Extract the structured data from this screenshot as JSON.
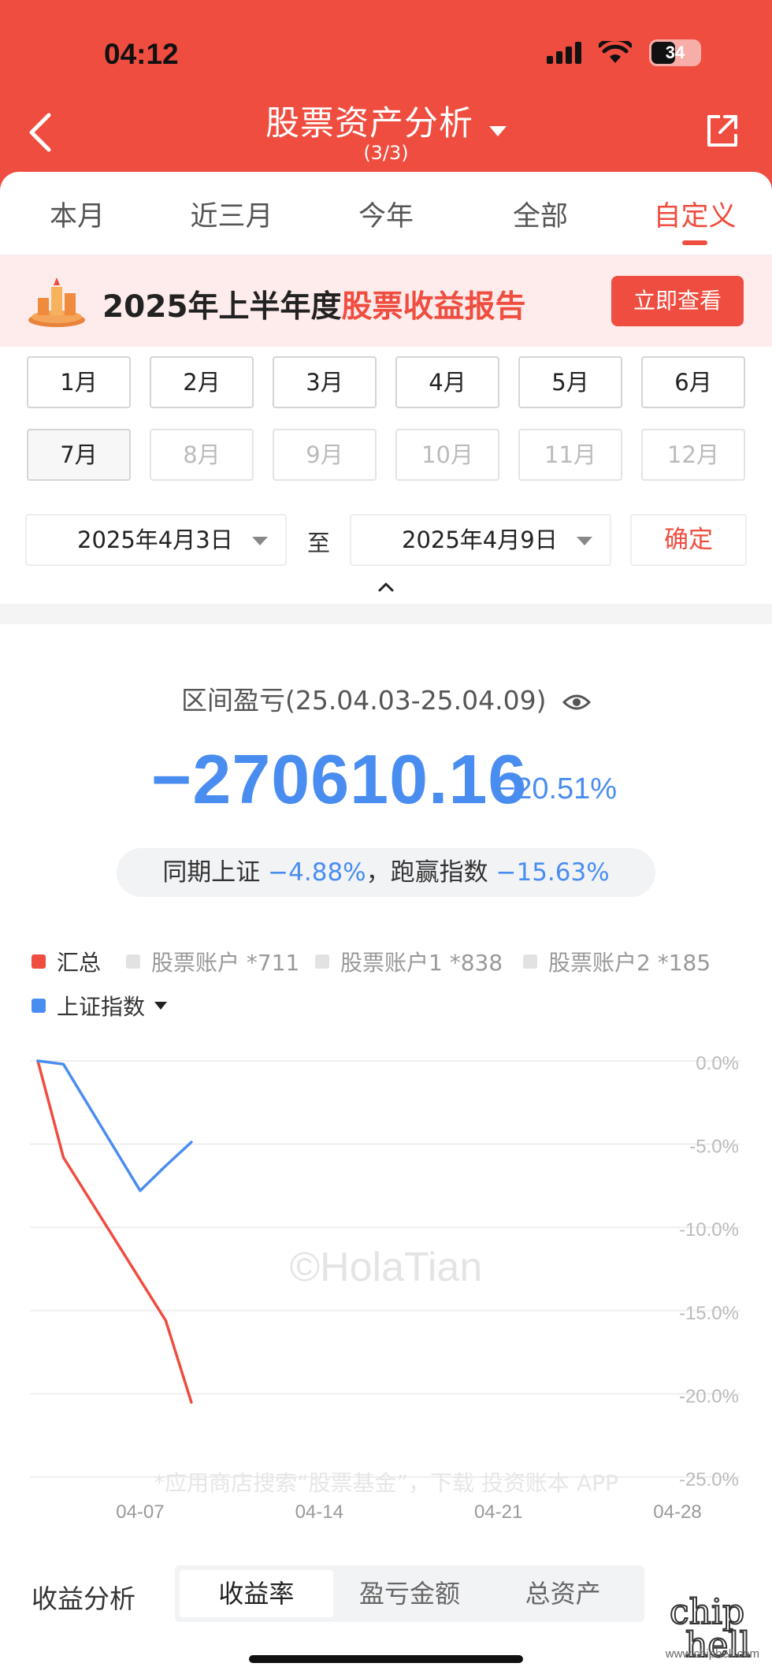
{
  "status_bar": {
    "time": "04:12",
    "battery": "34"
  },
  "header": {
    "title": "股票资产分析",
    "subtitle": "(3/3)"
  },
  "period_tabs": [
    {
      "label": "本月",
      "active": false
    },
    {
      "label": "近三月",
      "active": false
    },
    {
      "label": "今年",
      "active": false
    },
    {
      "label": "全部",
      "active": false
    },
    {
      "label": "自定义",
      "active": true
    }
  ],
  "banner": {
    "text_prefix": "2025年上半年度",
    "text_highlight": "股票收益报告",
    "button": "立即查看"
  },
  "months": [
    {
      "label": "1月",
      "enabled": true
    },
    {
      "label": "2月",
      "enabled": true
    },
    {
      "label": "3月",
      "enabled": true
    },
    {
      "label": "4月",
      "enabled": true
    },
    {
      "label": "5月",
      "enabled": true
    },
    {
      "label": "6月",
      "enabled": true
    },
    {
      "label": "7月",
      "enabled": true
    },
    {
      "label": "8月",
      "enabled": false
    },
    {
      "label": "9月",
      "enabled": false
    },
    {
      "label": "10月",
      "enabled": false
    },
    {
      "label": "11月",
      "enabled": false
    },
    {
      "label": "12月",
      "enabled": false
    }
  ],
  "date_range": {
    "start": "2025年4月3日",
    "to": "至",
    "end": "2025年4月9日",
    "confirm": "确定"
  },
  "summary": {
    "range_label": "区间盈亏(25.04.03-25.04.09)",
    "value": "−270610.16",
    "pct": "−20.51%",
    "compare_a_label": "同期上证",
    "compare_a_value": "−4.88%",
    "compare_sep": "，",
    "compare_b_label": "跑赢指数",
    "compare_b_value": "−15.63%"
  },
  "legend": [
    {
      "label": "汇总",
      "color": "#ef4d3f",
      "active": true
    },
    {
      "label": "股票账户  *711",
      "color": "#e2e2e2",
      "active": false
    },
    {
      "label": "股票账户1  *838",
      "color": "#e2e2e2",
      "active": false
    },
    {
      "label": "股票账户2  *185",
      "color": "#e2e2e2",
      "active": false
    },
    {
      "label": "上证指数",
      "color": "#4a8df0",
      "active": true
    }
  ],
  "chart_data": {
    "type": "line",
    "ylim": [
      -25,
      0
    ],
    "y_ticks": [
      "0.0%",
      "-5.0%",
      "-10.0%",
      "-15.0%",
      "-20.0%",
      "-25.0%"
    ],
    "x_ticks": [
      "04-07",
      "04-14",
      "04-21",
      "04-28"
    ],
    "x_range": [
      "2025-04-03",
      "2025-04-28"
    ],
    "series": [
      {
        "name": "汇总",
        "color": "#ef4d3f",
        "points": [
          {
            "x": "2025-04-03",
            "y": 0.0
          },
          {
            "x": "2025-04-04",
            "y": -5.8
          },
          {
            "x": "2025-04-08",
            "y": -15.6
          },
          {
            "x": "2025-04-09",
            "y": -20.51
          }
        ]
      },
      {
        "name": "上证指数",
        "color": "#4a8df0",
        "points": [
          {
            "x": "2025-04-03",
            "y": 0.0
          },
          {
            "x": "2025-04-04",
            "y": -0.2
          },
          {
            "x": "2025-04-07",
            "y": -7.8
          },
          {
            "x": "2025-04-08",
            "y": -6.3
          },
          {
            "x": "2025-04-09",
            "y": -4.88
          }
        ]
      }
    ]
  },
  "watermark": "©HolaTian",
  "promo": "*应用商店搜索“股票基金”，下载 投资账本 APP",
  "analysis": {
    "label": "收益分析",
    "tabs": [
      {
        "label": "收益率",
        "active": true
      },
      {
        "label": "盈亏金额",
        "active": false
      },
      {
        "label": "总资产",
        "active": false
      }
    ]
  },
  "corner_logo": {
    "text": "chip hell",
    "url": "www.chiphell.com"
  }
}
